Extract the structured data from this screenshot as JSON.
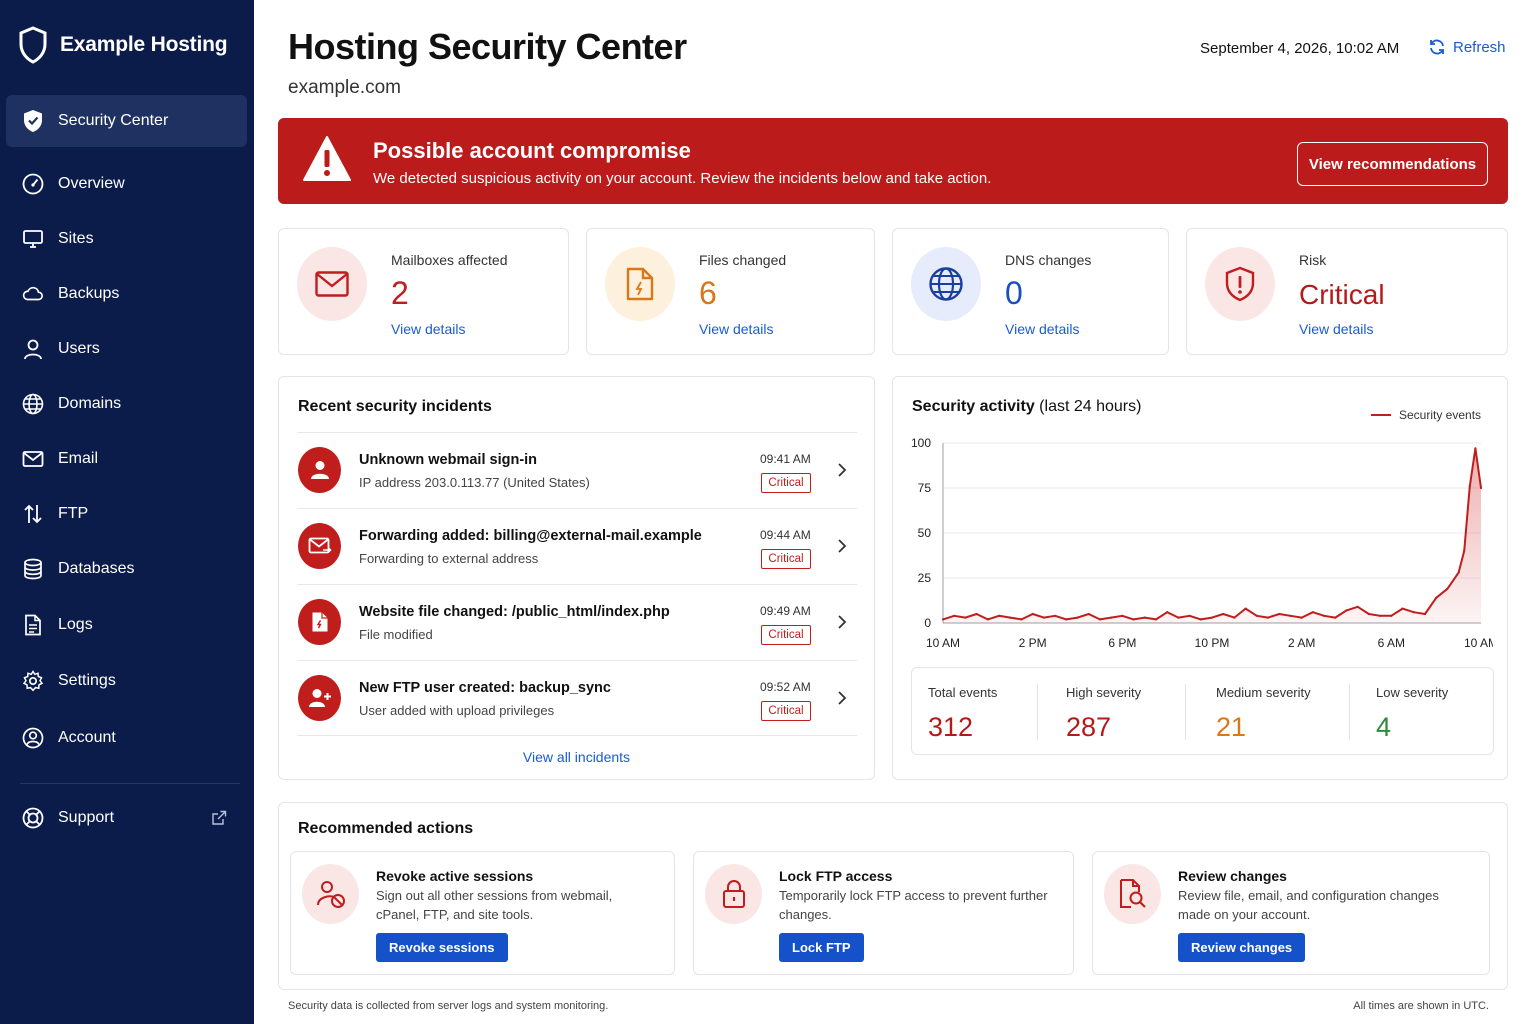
{
  "brand": {
    "name": "Example Hosting"
  },
  "nav": {
    "items": [
      {
        "label": "Security Center",
        "icon": "shield-icon"
      },
      {
        "label": "Overview",
        "icon": "gauge-icon"
      },
      {
        "label": "Sites",
        "icon": "monitor-icon"
      },
      {
        "label": "Backups",
        "icon": "cloud-icon"
      },
      {
        "label": "Users",
        "icon": "user-icon"
      },
      {
        "label": "Domains",
        "icon": "globe-icon"
      },
      {
        "label": "Email",
        "icon": "mail-icon"
      },
      {
        "label": "FTP",
        "icon": "transfer-icon"
      },
      {
        "label": "Databases",
        "icon": "database-icon"
      },
      {
        "label": "Logs",
        "icon": "file-icon"
      },
      {
        "label": "Settings",
        "icon": "gear-icon"
      },
      {
        "label": "Account",
        "icon": "account-icon"
      }
    ],
    "support": {
      "label": "Support",
      "icon": "lifebuoy-icon",
      "external_icon": "external-link-icon"
    }
  },
  "header": {
    "title": "Hosting Security Center",
    "subtitle": "example.com",
    "datetime": "September 4, 2026, 10:02 AM",
    "refresh_label": "Refresh"
  },
  "alert": {
    "title": "Possible account compromise",
    "text": "We detected suspicious activity on your account. Review the incidents below and take action.",
    "button": "View recommendations",
    "color": "#bb1b1b"
  },
  "stats": [
    {
      "label": "Mailboxes affected",
      "value": "2",
      "link": "View details",
      "icon": "mail-icon",
      "color": "#c01d1d",
      "bg": "#fbe6e6"
    },
    {
      "label": "Files changed",
      "value": "6",
      "link": "View details",
      "icon": "file-icon",
      "color": "#d9771a",
      "bg": "#fdf0dc"
    },
    {
      "label": "DNS changes",
      "value": "0",
      "link": "View details",
      "icon": "globe-icon",
      "color": "#1a4fc4",
      "bg": "#e6ecfb"
    },
    {
      "label": "Risk",
      "value": "Critical",
      "link": "View details",
      "icon": "shield-alert-icon",
      "color": "#c01d1d",
      "bg": "#fbe6e6"
    }
  ],
  "incidents": {
    "title": "Recent security incidents",
    "items": [
      {
        "title": "Unknown webmail sign-in",
        "subtitle": "IP address 203.0.113.77 (United States)",
        "time": "09:41 AM",
        "severity": "Critical",
        "icon": "user-icon"
      },
      {
        "title": "Forwarding added: billing@external-mail.example",
        "subtitle": "Forwarding to external address",
        "time": "09:44 AM",
        "severity": "Critical",
        "icon": "mail-forward-icon"
      },
      {
        "title": "Website file changed: /public_html/index.php",
        "subtitle": "File modified",
        "time": "09:49 AM",
        "severity": "Critical",
        "icon": "file-icon"
      },
      {
        "title": "New FTP user created: backup_sync",
        "subtitle": "User added with upload privileges",
        "time": "09:52 AM",
        "severity": "Critical",
        "icon": "user-add-icon"
      }
    ],
    "view_all": "View all incidents"
  },
  "activity": {
    "title_bold": "Security activity",
    "title_rest": " (last 24 hours)",
    "summary": [
      {
        "label": "Total events",
        "value": "312",
        "color": "#b31a1a"
      },
      {
        "label": "High severity",
        "value": "287",
        "color": "#b31a1a"
      },
      {
        "label": "Medium severity",
        "value": "21",
        "color": "#d9771a"
      },
      {
        "label": "Low severity",
        "value": "4",
        "color": "#2e8b3a"
      }
    ]
  },
  "chart_data": {
    "type": "area",
    "series": [
      {
        "name": "Security events",
        "color": "#c01d1d",
        "x": [
          0,
          0.5,
          1,
          1.5,
          2,
          2.5,
          3,
          3.5,
          4,
          4.5,
          5,
          5.5,
          6,
          6.5,
          7,
          7.5,
          8,
          8.5,
          9,
          9.5,
          10,
          10.5,
          11,
          11.5,
          12,
          12.5,
          13,
          13.5,
          14,
          14.5,
          15,
          15.5,
          16,
          16.5,
          17,
          17.5,
          18,
          18.5,
          19,
          19.5,
          20,
          20.5,
          21,
          21.5,
          22,
          22.5,
          23,
          23.25,
          23.5,
          23.75,
          24
        ],
        "values": [
          2,
          4,
          3,
          5,
          2,
          4,
          3,
          2,
          5,
          3,
          4,
          2,
          3,
          5,
          2,
          3,
          4,
          2,
          3,
          2,
          6,
          3,
          4,
          2,
          3,
          5,
          3,
          8,
          4,
          3,
          5,
          4,
          3,
          6,
          4,
          3,
          7,
          9,
          5,
          4,
          4,
          8,
          6,
          5,
          14,
          19,
          28,
          40,
          76,
          97,
          75
        ]
      }
    ],
    "x_ticks": [
      "10 AM",
      "2 PM",
      "6 PM",
      "10 PM",
      "2 AM",
      "6 AM",
      "10 AM"
    ],
    "y_ticks": [
      "100",
      "75",
      "50",
      "25",
      "0"
    ],
    "ylim": [
      0,
      100
    ],
    "xlim": [
      0,
      24
    ],
    "grid": true,
    "legend_position": "top-right"
  },
  "actions": {
    "title": "Recommended actions",
    "items": [
      {
        "title": "Revoke active sessions",
        "text": "Sign out all other sessions from webmail, cPanel, FTP, and site tools.",
        "button": "Revoke sessions",
        "icon": "revoke-user-icon"
      },
      {
        "title": "Lock FTP access",
        "text": "Temporarily lock FTP access to prevent further changes.",
        "button": "Lock FTP",
        "icon": "lock-icon"
      },
      {
        "title": "Review changes",
        "text": "Review file, email, and configuration changes made on your account.",
        "button": "Review changes",
        "icon": "search-file-icon"
      }
    ]
  },
  "footer": {
    "left": "Security data is collected from server logs and system monitoring.",
    "right": "All times are shown in UTC."
  }
}
